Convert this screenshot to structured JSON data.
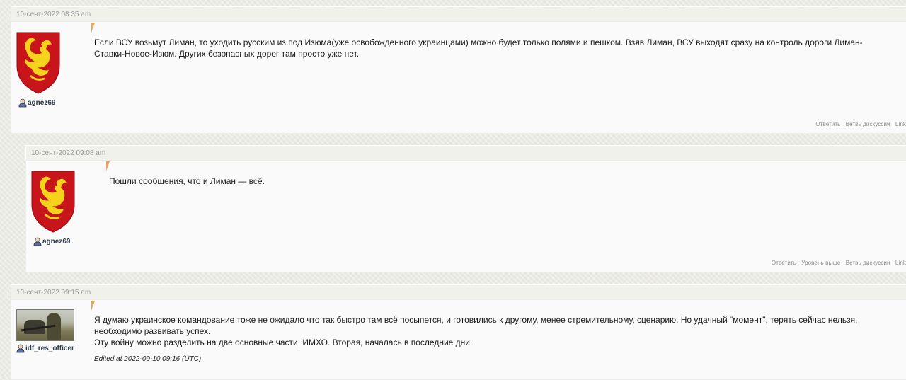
{
  "comments": [
    {
      "date": "10-сент-2022 08:35 am",
      "username": "agnez69",
      "userpic": "heraldic-phoenix-shield",
      "text": "Если ВСУ возьмут Лиман, то уходить русским из под Изюма(уже освобожденного украинцами) можно будет только полями и пешком. Взяв Лиман, ВСУ выходят сразу на контроль дороги Лиман-Ставки-Новое-Изюм. Других безопасных дорог там просто уже нет.",
      "actions": [
        "Ответить",
        "Ветвь дискуссии",
        "Link"
      ]
    },
    {
      "date": "10-сент-2022 09:08 am",
      "username": "agnez69",
      "userpic": "heraldic-phoenix-shield",
      "text": "Пошли сообщения, что и Лиман — всё.",
      "actions": [
        "Ответить",
        "Уровень выше",
        "Ветвь дискуссии",
        "Link"
      ]
    },
    {
      "date": "10-сент-2022 09:15 am",
      "username": "idf_res_officer",
      "userpic": "soldier-photo",
      "text_lines": [
        "Я думаю украинское командование тоже не ожидало что так быстро там всё посыпется, и готовились к другому, менее стремительному, сценарию. Но удачный \"момент\", терять сейчас нельзя, необходимо развивать успех.",
        "Эту войну можно разделить на две основные части, ИМХО. Вторая, началась в последние дни."
      ],
      "edited": "Edited at 2022-09-10 09:16 (UTC)"
    }
  ],
  "colors": {
    "marker": "#f2a35a",
    "shield_red": "#c8141b",
    "phoenix_gold": "#f5d21c",
    "username": "#2b3947"
  },
  "icons": {
    "user": "user-icon"
  }
}
